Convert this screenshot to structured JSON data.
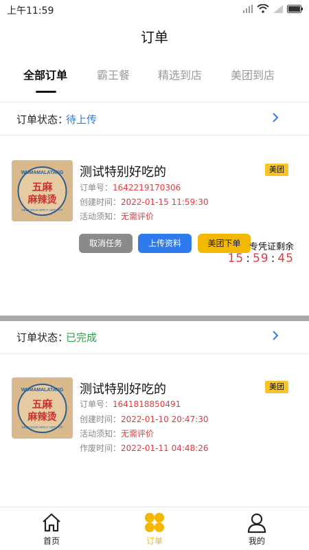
{
  "status_bar": {
    "time": "上午11:59",
    "battery": "battery-icon",
    "signal": "signal-icon",
    "wifi": "wifi-icon"
  },
  "nav": {
    "title": "订单"
  },
  "tabs": [
    {
      "label": "全部订单",
      "active": true
    },
    {
      "label": "霸王餐",
      "active": false
    },
    {
      "label": "精选到店",
      "active": false
    },
    {
      "label": "美团到店",
      "active": false
    }
  ],
  "orders": [
    {
      "status_label": "订单状态：",
      "status_value": "待上传",
      "status_color": "#2b7de9",
      "title": "测试特别好吃的",
      "badge": "美团",
      "badge_color": "#f6c427",
      "order_no_label": "订单号：",
      "order_no": "1642219170306",
      "created_label": "创建时间：",
      "created": "2022-01-15 11:59:30",
      "notice_label": "活动须知：",
      "notice": "无需评价",
      "buttons": {
        "cancel": "取消任务",
        "upload": "上传资料",
        "meituan": "美团下单"
      },
      "countdown_label": "专凭证剩余",
      "countdown": {
        "h": "15",
        "m": "59",
        "s": "45"
      }
    },
    {
      "status_label": "订单状态：",
      "status_value": "已完成",
      "status_color": "#2aa14a",
      "title": "测试特别好吃的",
      "badge": "美团",
      "badge_color": "#f6c427",
      "order_no_label": "订单号：",
      "order_no": "1641818850491",
      "created_label": "创建时间：",
      "created": "2022-01-10 20:47:30",
      "notice_label": "活动须知：",
      "notice": "无需评价",
      "void_label": "作废时间：",
      "void_time": "2022-01-11 04:48:26"
    }
  ],
  "thumb": {
    "brand_top": "WUMAMALATANG",
    "brand_cn": "五麻",
    "brand_cn2": "麻辣烫",
    "tag": "DELICIOUS SPICY HOT POT"
  },
  "bottom_nav": [
    {
      "label": "首页",
      "icon": "home-icon",
      "active": false
    },
    {
      "label": "订单",
      "icon": "order-icon",
      "active": true
    },
    {
      "label": "我的",
      "icon": "profile-icon",
      "active": false
    }
  ],
  "colors": {
    "accent_yellow": "#f5b800",
    "primary_blue": "#2f7bec",
    "red": "#e4393c"
  }
}
